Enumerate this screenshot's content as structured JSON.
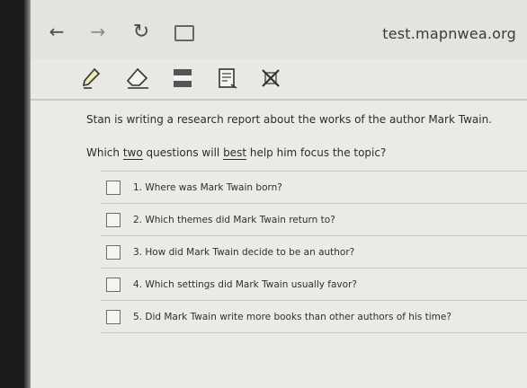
{
  "browser": {
    "url": "test.mapnwea.org",
    "back_glyph": "←",
    "forward_glyph": "→",
    "reload_glyph": "↻"
  },
  "toolbar": {
    "tools": [
      {
        "icon": "pencil-icon"
      },
      {
        "icon": "eraser-icon"
      },
      {
        "icon": "line-reader-icon"
      },
      {
        "icon": "notepad-icon"
      },
      {
        "icon": "answer-eliminator-icon"
      }
    ]
  },
  "question": {
    "prompt": "Stan is writing a research report about the works of the author Mark Twain.",
    "stem_pre": "Which ",
    "stem_u1": "two",
    "stem_mid": " questions will ",
    "stem_u2": "best",
    "stem_post": " help him focus the topic?",
    "options": [
      "1.   Where was Mark Twain born?",
      "2.   Which themes did Mark Twain return to?",
      "3.   How did Mark Twain decide to be an author?",
      "4.   Which settings did Mark Twain usually favor?",
      "5.   Did Mark Twain write more books than other authors of his time?"
    ]
  }
}
